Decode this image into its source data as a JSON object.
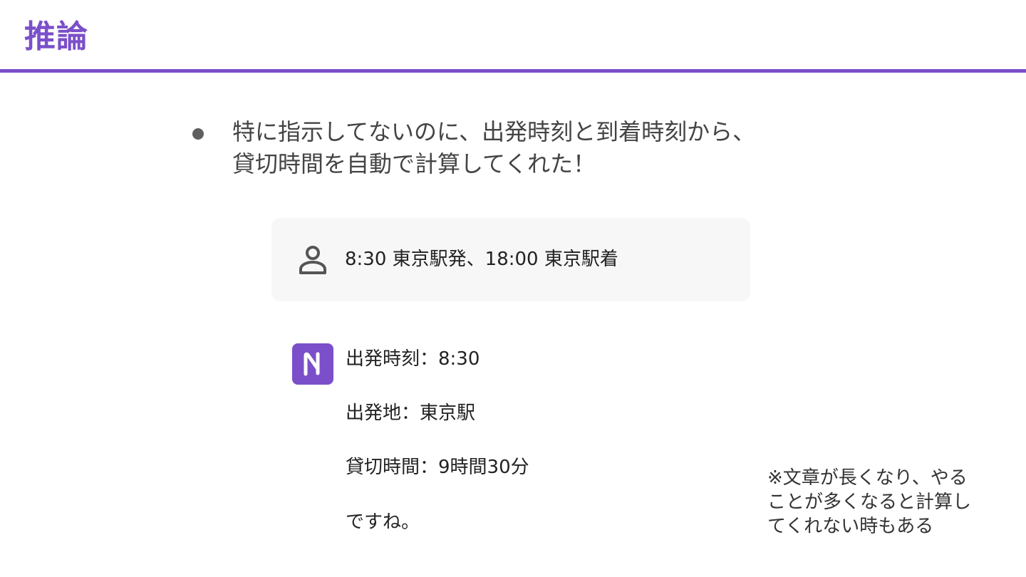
{
  "slide": {
    "title": "推論",
    "accent_color": "#7B4FC9"
  },
  "bullet": {
    "line1": "特に指示してないのに、出発時刻と到着時刻から、",
    "line2": "貸切時間を自動で計算してくれた！"
  },
  "chat": {
    "user_icon": "person-icon",
    "user_message": "8:30 東京駅発、18:00 東京駅着",
    "bot_icon": "notion-ai-logo-icon",
    "bot_lines": [
      "出発時刻：8:30",
      "出発地：東京駅",
      "貸切時間：9時間30分",
      "ですね。"
    ]
  },
  "note": {
    "line1": "※文章が長くなり、やる",
    "line2": "ことが多くなると計算し",
    "line3": "てくれない時もある"
  }
}
